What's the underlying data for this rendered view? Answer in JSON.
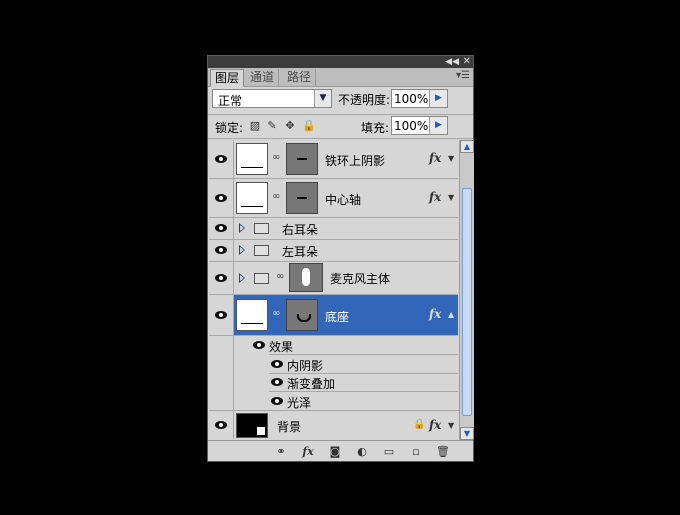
{
  "panel": {
    "tabs": [
      {
        "label": "图层"
      },
      {
        "label": "通道"
      },
      {
        "label": "路径"
      }
    ],
    "blend_mode": "正常",
    "opacity_label": "不透明度:",
    "opacity_value": "100%",
    "lock_label": "锁定:",
    "fill_label": "填充:",
    "fill_value": "100%"
  },
  "layers": [
    {
      "name": "铁环上阴影",
      "type": "layer",
      "selected": false,
      "fx": true
    },
    {
      "name": "中心轴",
      "type": "layer",
      "selected": false,
      "fx": true
    },
    {
      "name": "右耳朵",
      "type": "group",
      "selected": false
    },
    {
      "name": "左耳朵",
      "type": "group",
      "selected": false
    },
    {
      "name": "麦克风主体",
      "type": "group",
      "selected": false
    },
    {
      "name": "底座",
      "type": "layer",
      "selected": true,
      "fx": true
    }
  ],
  "effects": {
    "header": "效果",
    "items": [
      "内阴影",
      "渐变叠加",
      "光泽"
    ]
  },
  "background_layer": {
    "name": "背景"
  },
  "colors": {
    "selection": "#3266b9",
    "panel_bg": "#d6d6d6",
    "window_bg": "#000000"
  }
}
